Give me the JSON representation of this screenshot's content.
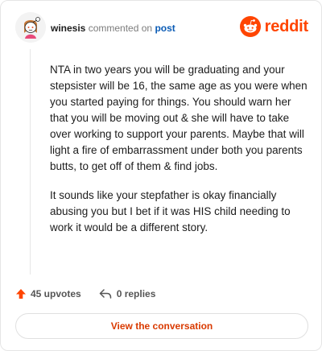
{
  "header": {
    "username": "winesis",
    "verb": "commented on",
    "post_link": "post",
    "brand": "reddit"
  },
  "comment": {
    "paragraphs": [
      "NTA in two years you will be graduating and your stepsister will be 16, the same age as you were when you started paying for things. You should warn her that you will be moving out & she will have to take over working to support your parents. Maybe that will light a fire of embarrassment under both you parents butts, to get off of them & find jobs.",
      "It sounds like your stepfather is okay financially abusing you but I bet if it was HIS child needing to work it would be a different story."
    ]
  },
  "actions": {
    "upvotes": "45 upvotes",
    "replies": "0 replies"
  },
  "cta": {
    "label": "View the conversation"
  },
  "colors": {
    "brand": "#ff4500",
    "link": "#0a5bb5",
    "cta": "#d93a00"
  },
  "icons": [
    "snoo-avatar-icon",
    "reddit-logo-icon",
    "upvote-arrow-icon",
    "reply-arrow-icon"
  ]
}
